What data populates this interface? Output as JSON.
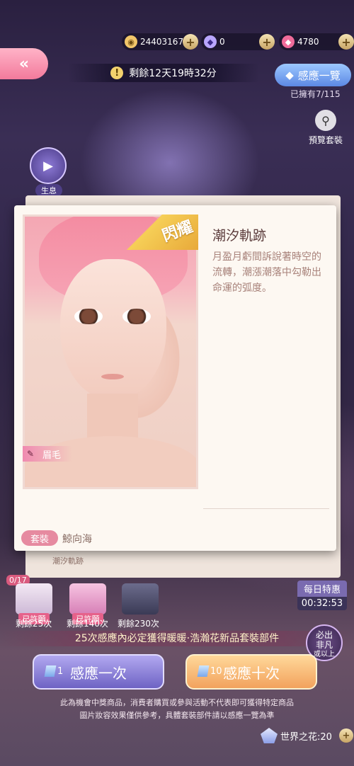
{
  "currency": {
    "gold": "24403167",
    "diamond": "0",
    "gem": "4780"
  },
  "back_icon": "«",
  "timer": {
    "text": "剩餘12天19時32分"
  },
  "gallery": {
    "label": "感應一覽",
    "owned": "已擁有7/115"
  },
  "preview": {
    "label": "預覽套裝"
  },
  "story": {
    "label": "生息"
  },
  "item": {
    "rarity": "閃耀",
    "title": "潮汐軌跡",
    "description": "月盈月虧間訴說著時空的流轉，潮漲潮落中勾勒出命運的弧度。",
    "part": "眉毛",
    "suit_label": "套裝",
    "suit_name": "鯨向海",
    "set_item": "潮汐軌跡"
  },
  "rewards": {
    "counter": "0/17",
    "items": [
      {
        "status": "已許願",
        "remaining": "剩餘25次"
      },
      {
        "status": "已許願",
        "remaining": "剩餘140次"
      },
      {
        "status": "",
        "remaining": "剩餘230次"
      }
    ]
  },
  "daily": {
    "label": "每日特惠",
    "time": "00:32:53"
  },
  "guarantee": "25次感應內必定獲得暖暖·浩瀚花新品套裝部件",
  "badge": {
    "line1": "必出",
    "line2": "非凡",
    "line3": "或以上"
  },
  "draw": {
    "one": {
      "count": "1",
      "label": "感應一次"
    },
    "ten": {
      "count": "10",
      "label": "感應十次"
    }
  },
  "disclaimer": {
    "line1": "此為機會中獎商品，消費者購買或參與活動不代表即可獲得特定商品",
    "line2": "圖片妝容效果僅供參考，具體套裝部件請以感應一覽為準"
  },
  "world_flower": {
    "label": "世界之花:20"
  },
  "colors": {
    "accent_pink": "#f37a9c",
    "accent_blue": "#5c88e4",
    "draw_one": "#6e63c4",
    "draw_ten": "#f2a25d"
  }
}
